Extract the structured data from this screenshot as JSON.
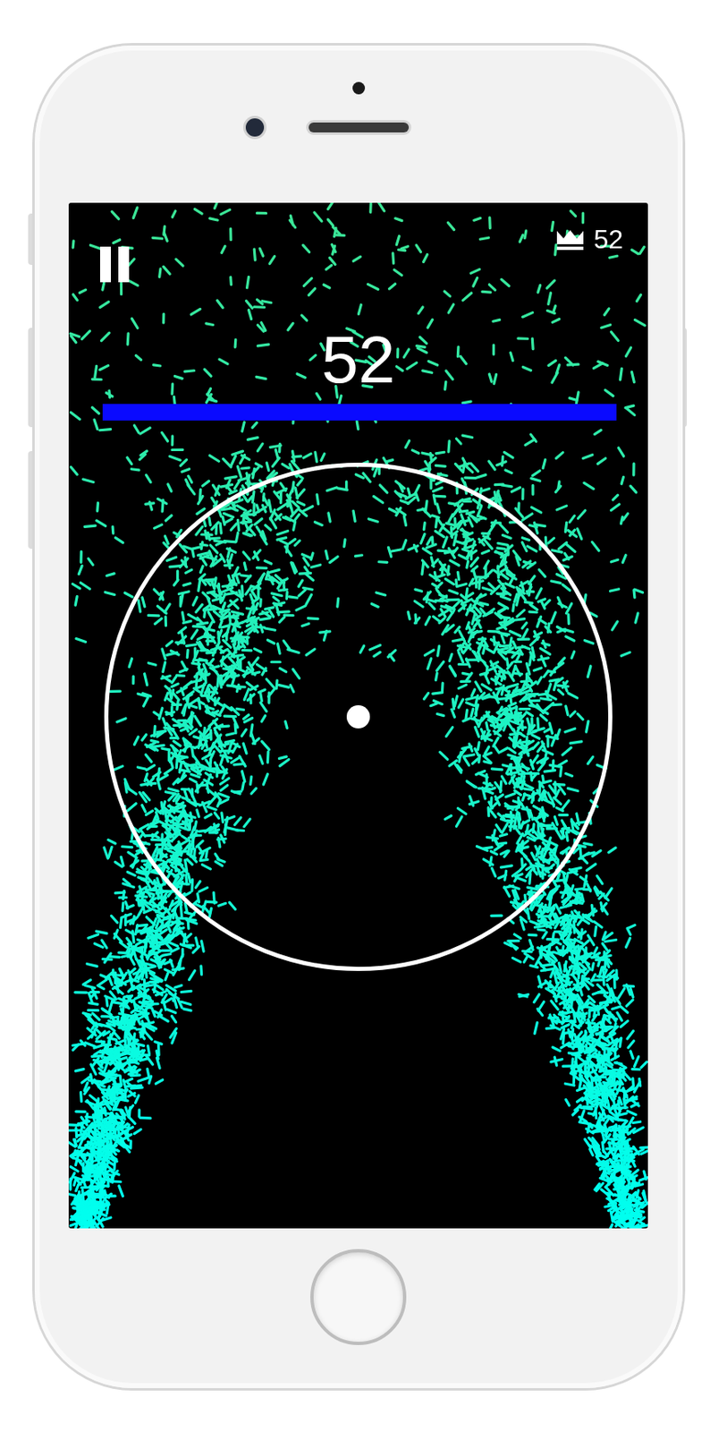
{
  "hud": {
    "best": "52",
    "score": "52"
  }
}
